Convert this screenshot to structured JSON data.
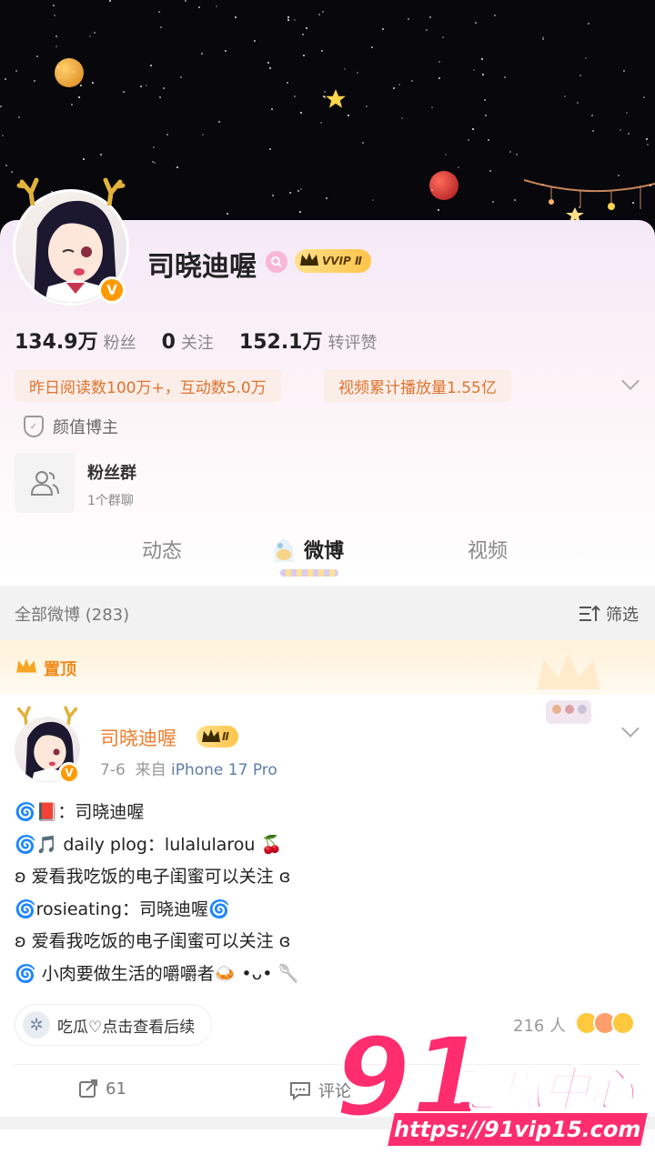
{
  "profile": {
    "name": "司晓迪喔",
    "vip_label": "VVIP Ⅱ",
    "stats": [
      {
        "value": "134.9万",
        "label": "粉丝"
      },
      {
        "value": "0",
        "label": "关注"
      },
      {
        "value": "152.1万",
        "label": "转评赞"
      }
    ],
    "tags": [
      "昨日阅读数100万+，互动数5.0万",
      "视频累计播放量1.55亿"
    ],
    "category": "颜值博主"
  },
  "fan_group": {
    "title": "粉丝群",
    "subtitle": "1个群聊"
  },
  "tabs": [
    "动态",
    "微博",
    "视频"
  ],
  "feed": {
    "all_label": "全部微博 (283)",
    "filter_label": "筛选",
    "pinned_label": "置顶"
  },
  "post": {
    "author": "司晓迪喔",
    "vip_label": "Ⅱ",
    "date": "7-6",
    "source_prefix": "来自",
    "device": "iPhone 17 Pro",
    "lines": [
      "🌀📕：司晓迪喔",
      "🌀🎵 daily plog：lulalularou 🍒",
      "ʚ 爱看我吃饭的电子闺蜜可以关注 ɞ",
      "🌀rosieating：司晓迪喔🌀",
      "ʚ 爱看我吃饭的电子闺蜜可以关注 ɞ",
      "🌀 小肉要做生活的嚼嚼者🍛 •ᴗ• 🥄"
    ],
    "topic_pill": "吃瓜♡点击查看后续",
    "likes_people": "216 人",
    "repost_count": "61",
    "comment_label": "评论"
  },
  "watermark": {
    "big": "91",
    "cn": "吃瓜中心",
    "url": "https://91vip15.com"
  },
  "colors": {
    "accent_orange": "#f07b2a",
    "vip_gold": "#ffc44a",
    "watermark_pink": "#ff2d6e"
  }
}
